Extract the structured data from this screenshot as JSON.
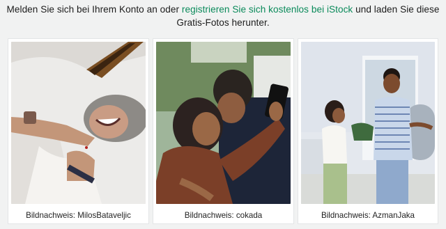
{
  "intro": {
    "part1": "Melden Sie sich bei Ihrem Konto an oder ",
    "link": "registrieren Sie sich kostenlos bei iStock",
    "part2": " und laden Sie diese Gratis-Fotos herunter."
  },
  "colors": {
    "link": "#0a8a5a",
    "background": "#f1f2f2"
  },
  "photos": [
    {
      "credit": "Bildnachweis: MilosBataveljic",
      "alt_icon": "photo-laughing-woman"
    },
    {
      "credit": "Bildnachweis: cokada",
      "alt_icon": "photo-couple-selfie"
    },
    {
      "credit": "Bildnachweis: AzmanJaka",
      "alt_icon": "photo-couple-moving"
    }
  ]
}
